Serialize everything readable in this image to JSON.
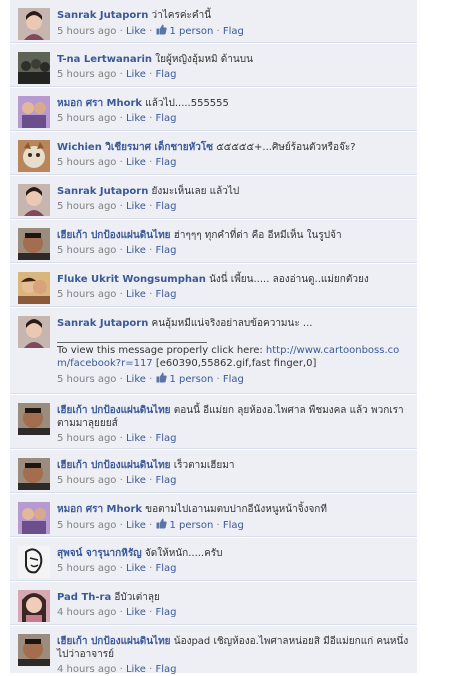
{
  "comments": [
    {
      "name": "Sanrak Jutaporn",
      "text": "ว่าไครค่ะคำนี้",
      "time": "5 hours ago",
      "like_label": "Like",
      "likes": "1 person",
      "flag_label": "Flag"
    },
    {
      "name": "T-na Lertwanarin",
      "text": "ใยผู้หญิงอุ้มหมิ ด้านบน",
      "time": "5 hours ago",
      "like_label": "Like",
      "flag_label": "Flag"
    },
    {
      "name": "หมอก ศรา Mhork",
      "text": "แล้วไป.....555555",
      "time": "5 hours ago",
      "like_label": "Like",
      "flag_label": "Flag"
    },
    {
      "name": "Wichien วิเชียรมาศ เด็กชายหัวโซ",
      "text": "๕๕๕๕๕+...ศิษย์ร้อนตัวหรือจ๊ะ?",
      "time": "5 hours ago",
      "like_label": "Like",
      "flag_label": "Flag"
    },
    {
      "name": "Sanrak Jutaporn",
      "text": "ยังมะเห็นเลย แล้วไป",
      "time": "5 hours ago",
      "like_label": "Like",
      "flag_label": "Flag"
    },
    {
      "name": "เฮียเก้า ปกป้องแผ่นดินไทย",
      "text": "ฮ่าๆๆๆ ทุกคำที่ด่า คือ อีหมีเห็น ในรูปจ้า",
      "time": "5 hours ago",
      "like_label": "Like",
      "flag_label": "Flag"
    },
    {
      "name": "Fluke Ukrit Wongsumphan",
      "text": "นังนี่ เพี้ยน..... ลองอ่านดู..แม่ยกตัวยง",
      "time": "5 hours ago",
      "like_label": "Like",
      "flag_label": "Flag"
    },
    {
      "name": "Sanrak Jutaporn",
      "text": "คนอุ้มหมีแน่จริงอย่าลบข้อความนะ ...",
      "text2": "To view this message properly click here:",
      "url": "http://www.cartoonboss.com/facebook?r=117",
      "text3": "[e60390,55862.gif,fast finger,0]",
      "time": "5 hours ago",
      "like_label": "Like",
      "likes": "1 person",
      "flag_label": "Flag"
    },
    {
      "name": "เฮียเก้า ปกป้องแผ่นดินไทย",
      "text": "ตอนนี้ อีแม่ยก ลุยห้องอ.ไพศาล พืชมงคล แล้ว พวกเราตามมาลุยยยส์",
      "time": "5 hours ago",
      "like_label": "Like",
      "flag_label": "Flag"
    },
    {
      "name": "เฮียเก้า ปกป้องแผ่นดินไทย",
      "text": "เร็วตามเฮียมา",
      "time": "5 hours ago",
      "like_label": "Like",
      "flag_label": "Flag"
    },
    {
      "name": "หมอก ศรา Mhork",
      "text": "ขอตามไปเอานมตบปากอีนังหนูหน้าจิ้งจกที",
      "time": "5 hours ago",
      "like_label": "Like",
      "likes": "1 person",
      "flag_label": "Flag"
    },
    {
      "name": "สุพจน์ จารุนากหิรัญ",
      "text": "จัดให้หนัก.....ครับ",
      "time": "5 hours ago",
      "like_label": "Like",
      "flag_label": "Flag"
    },
    {
      "name": "Pad Th-ra",
      "text": "อีบัวเต่าลุย",
      "time": "4 hours ago",
      "like_label": "Like",
      "flag_label": "Flag"
    },
    {
      "name": "เฮียเก้า ปกป้องแผ่นดินไทย",
      "text": "น้องpad เชิญห้องอ.ไพศาลหน่อยสิ มีอีแม่ยกแก่ คนหนึ่งไปว่าอาจารย์",
      "time": "4 hours ago",
      "like_label": "Like",
      "flag_label": "Flag"
    }
  ]
}
